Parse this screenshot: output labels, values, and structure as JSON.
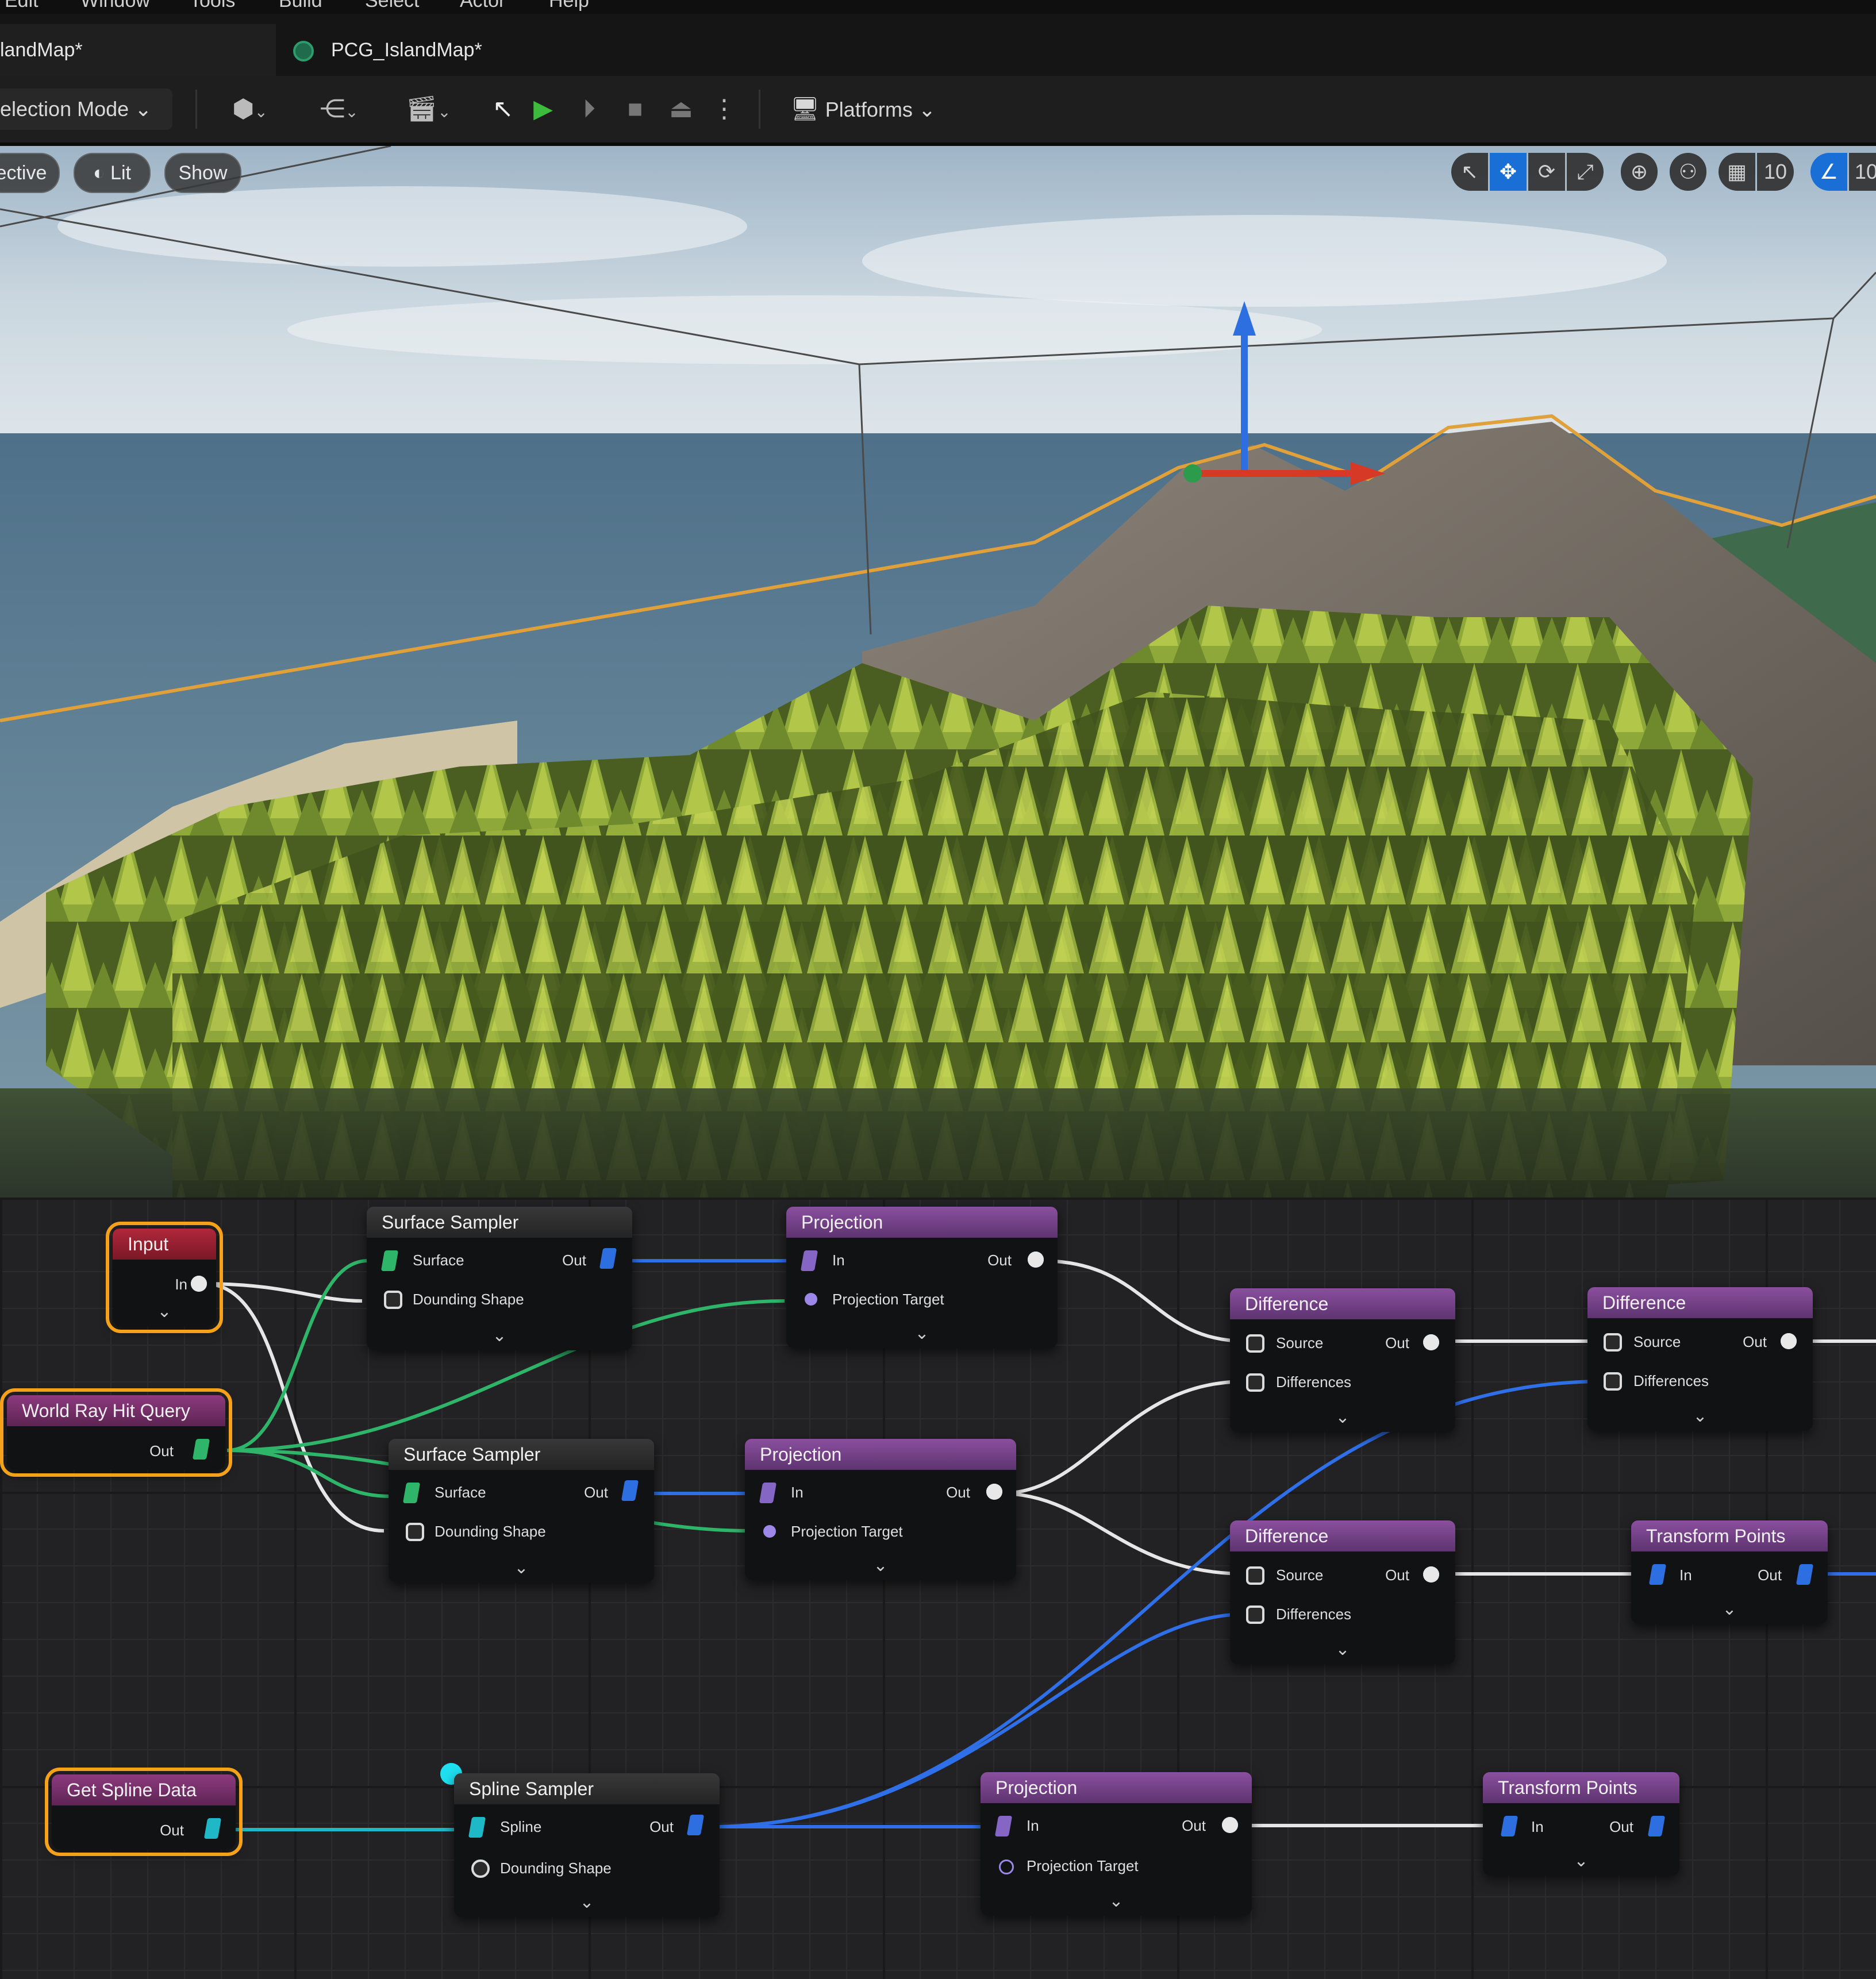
{
  "menu": [
    "Edit",
    "Window",
    "Tools",
    "Build",
    "Select",
    "Actor",
    "Help"
  ],
  "tabs": [
    {
      "label": "landMap*"
    },
    {
      "label": "PCG_IslandMap*"
    }
  ],
  "toolbar": {
    "selection_mode": "election Mode",
    "platforms": "Platforms"
  },
  "viewport": {
    "perspective_label": "ective",
    "lit_label": "Lit",
    "show_label": "Show",
    "grid_snap_value": "10",
    "angle_snap_value": "10"
  },
  "colors": {
    "selection_outline": "#f5a21a",
    "wire_green": "#2fb56a",
    "wire_blue": "#2f6fe8",
    "wire_white": "#e6e6e6",
    "wire_cyan": "#1fb8c6",
    "node_title_purple": "#7a4690"
  },
  "graph": {
    "input": {
      "title": "Input",
      "in": "In"
    },
    "world_ray": {
      "title": "World Ray Hit Query",
      "out": "Out"
    },
    "get_spline": {
      "title": "Get Spline Data",
      "out": "Out"
    },
    "surface_sampler_1": {
      "title": "Surface Sampler",
      "surface": "Surface",
      "bounding": "Dounding Shape",
      "out": "Out"
    },
    "surface_sampler_2": {
      "title": "Surface Sampler",
      "surface": "Surface",
      "bounding": "Dounding Shape",
      "out": "Out"
    },
    "spline_sampler": {
      "title": "Spline Sampler",
      "spline": "Spline",
      "bounding": "Dounding Shape",
      "out": "Out"
    },
    "projection_1": {
      "title": "Projection",
      "in": "In",
      "target": "Projection Target",
      "out": "Out"
    },
    "projection_2": {
      "title": "Projection",
      "in": "In",
      "target": "Projection Target",
      "out": "Out"
    },
    "projection_3": {
      "title": "Projection",
      "in": "In",
      "target": "Projection Target",
      "out": "Out"
    },
    "difference_1": {
      "title": "Difference",
      "source": "Source",
      "differences": "Differences",
      "out": "Out"
    },
    "difference_2": {
      "title": "Difference",
      "source": "Source",
      "differences": "Differences",
      "out": "Out"
    },
    "difference_3": {
      "title": "Difference",
      "source": "Source",
      "differences": "Differences",
      "out": "Out"
    },
    "transform_1": {
      "title": "Transform Points",
      "in": "In",
      "out": "Out"
    },
    "transform_2": {
      "title": "Transform Points",
      "in": "In",
      "out": "Out"
    }
  }
}
